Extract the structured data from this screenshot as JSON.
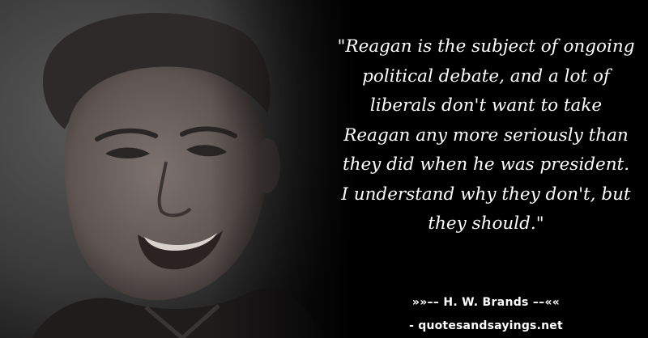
{
  "quote": {
    "lines": [
      "\"Reagan is the subject of ongoing",
      "political debate, and a lot of",
      "liberals don't want to take",
      "Reagan any more seriously than",
      "they did when he was president.",
      "I understand why they don't, but",
      "they should.\""
    ]
  },
  "attribution": {
    "author_line": "»»–– H. W. Brands ––««",
    "site_line": "- quotesandsayings.net"
  },
  "colors": {
    "background": "#000000",
    "text": "#ffffff"
  }
}
